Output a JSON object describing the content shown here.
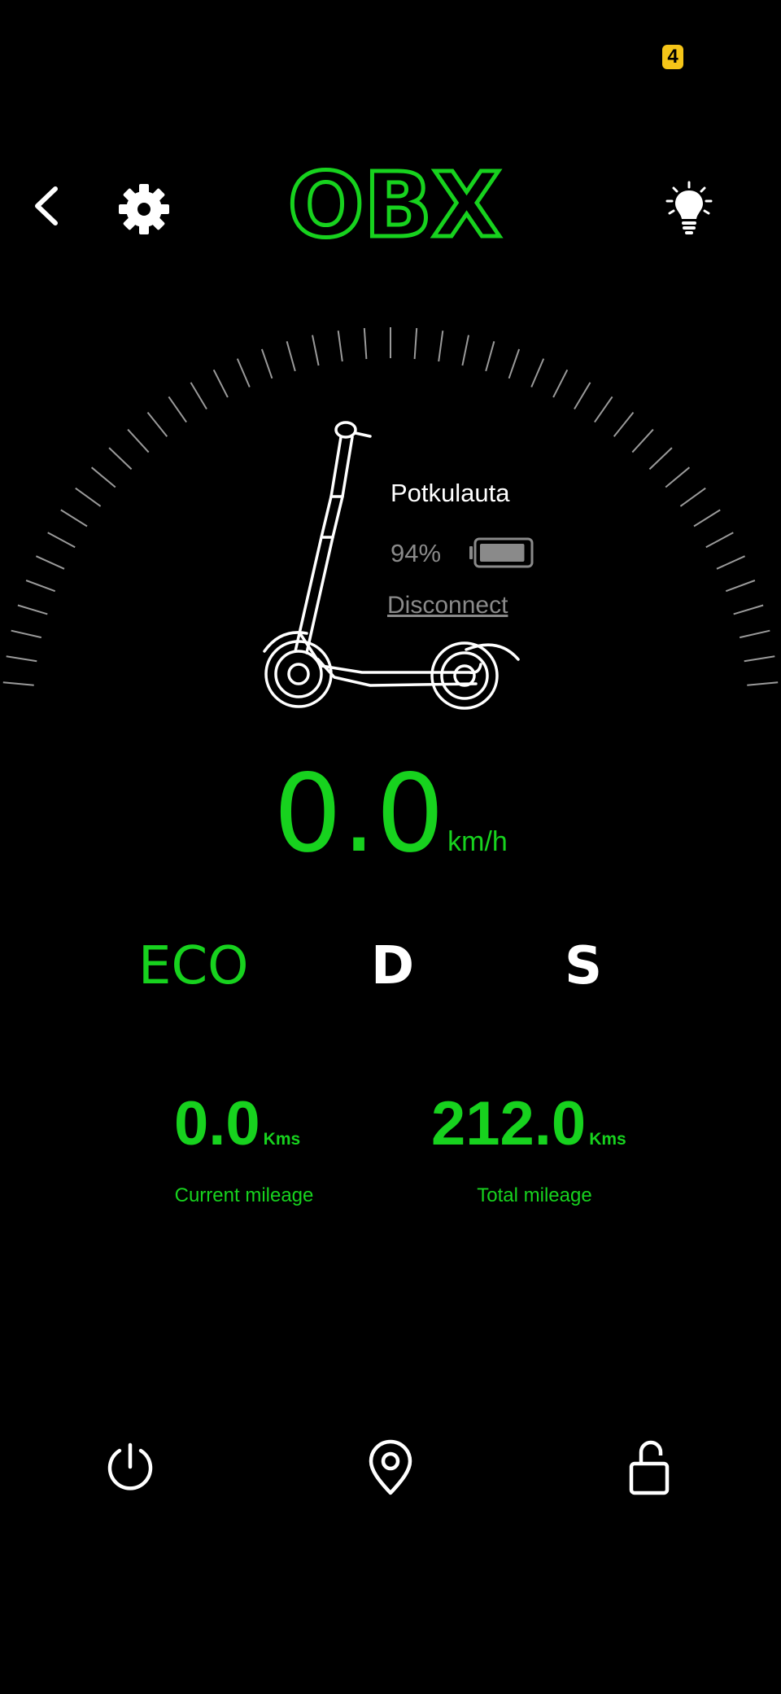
{
  "status_bar": {
    "badge": "4"
  },
  "header": {
    "logo_text": "OBX",
    "back_icon": "chevron-left-icon",
    "settings_icon": "gear-icon",
    "light_icon": "light-bulb-icon"
  },
  "device": {
    "name": "Potkulauta",
    "battery_percent": "94%",
    "battery_level": 0.94,
    "disconnect_label": "Disconnect"
  },
  "speed": {
    "value": "0.0",
    "unit": "km/h"
  },
  "modes": [
    {
      "label": "ECO",
      "active": true
    },
    {
      "label": "D",
      "active": false
    },
    {
      "label": "S",
      "active": false
    }
  ],
  "mileage": {
    "current": {
      "value": "0.0",
      "unit": "Kms",
      "label": "Current mileage"
    },
    "total": {
      "value": "212.0",
      "unit": "Kms",
      "label": "Total mileage"
    }
  },
  "bottom_bar": {
    "icons": [
      "power-icon",
      "location-pin-icon",
      "unlock-icon"
    ]
  },
  "colors": {
    "accent": "#17d21e",
    "background": "#000000",
    "muted": "#8a8a8a",
    "badge": "#f5c518"
  }
}
